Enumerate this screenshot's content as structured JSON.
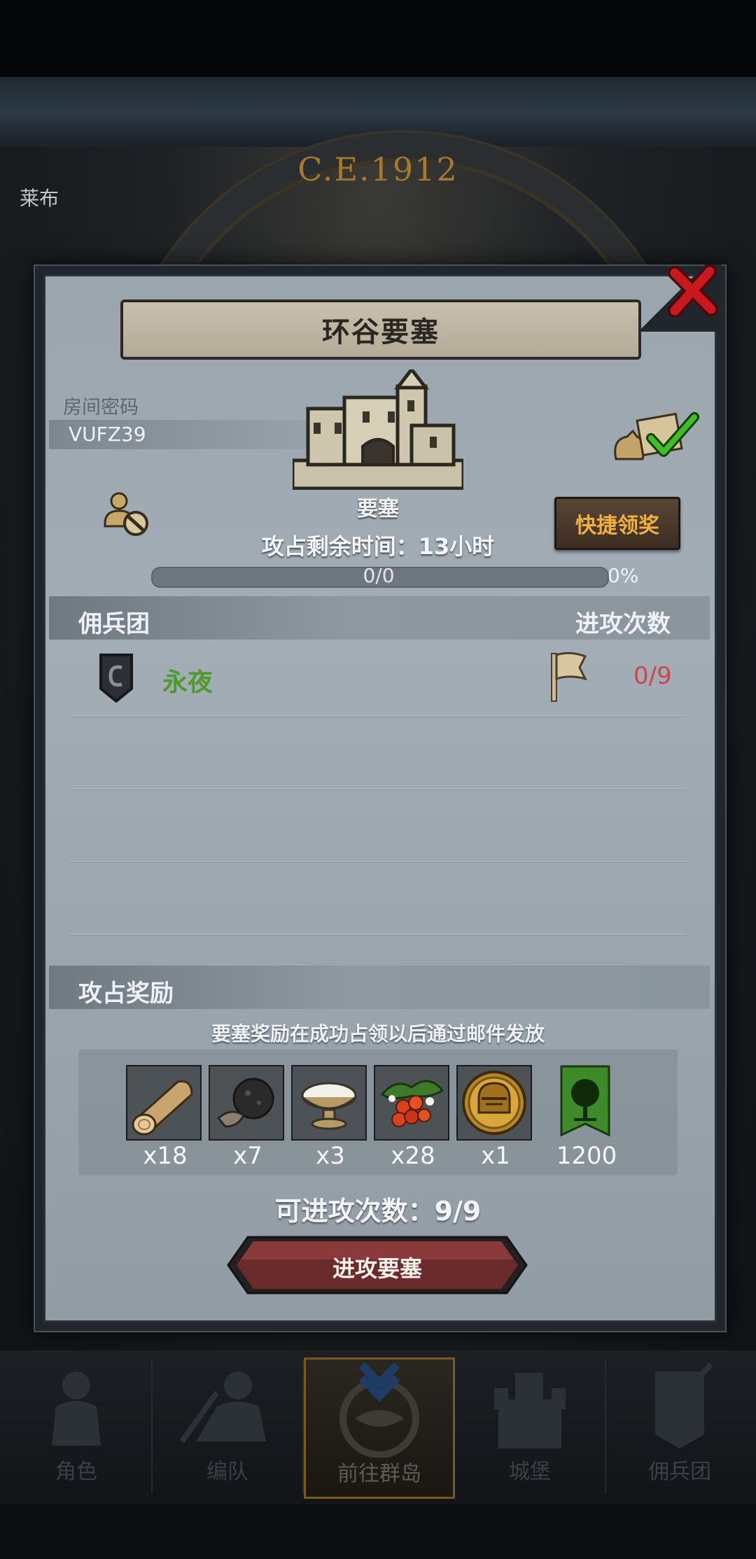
{
  "background": {
    "era_label": "C.E.1912",
    "side_label": "莱布"
  },
  "modal": {
    "title": "环谷要塞",
    "room": {
      "label": "房间密码",
      "code": "VUFZ39"
    },
    "fortress": {
      "type_label": "要塞"
    },
    "time_remaining": "攻占剩余时间：13小时",
    "quick_claim_label": "快捷领奖",
    "progress": {
      "text": "0/0",
      "percent_label": "0%",
      "fraction": 0.0
    },
    "mercenary_header": "佣兵团",
    "attack_count_header": "进攻次数",
    "guilds": [
      {
        "name": "永夜",
        "attacks": "0/9"
      }
    ],
    "rewards_header": "攻占奖励",
    "rewards_note": "要塞奖励在成功占领以后通过邮件发放",
    "rewards": [
      {
        "icon": "log-icon",
        "qty": "x18"
      },
      {
        "icon": "truffle-icon",
        "qty": "x7"
      },
      {
        "icon": "salt-bowl-icon",
        "qty": "x3"
      },
      {
        "icon": "berries-icon",
        "qty": "x28"
      },
      {
        "icon": "knight-helmet-coin-icon",
        "qty": "x1"
      },
      {
        "icon": "guild-banner-icon",
        "qty": "1200"
      }
    ],
    "attempts_label": "可进攻次数：9/9",
    "attack_button_label": "进攻要塞"
  },
  "nav": {
    "items": [
      {
        "label": "角色",
        "icon": "knight-icon"
      },
      {
        "label": "编队",
        "icon": "formation-icon"
      },
      {
        "label": "前往群岛",
        "icon": "compass-icon",
        "active": true
      },
      {
        "label": "城堡",
        "icon": "castle-icon"
      },
      {
        "label": "佣兵团",
        "icon": "mercenary-icon"
      }
    ]
  },
  "colors": {
    "guild_name": "#4e9a2a",
    "attack_count": "#d0434a",
    "quick_claim_text": "#f0b040",
    "close_button": "#c9181e",
    "attack_button": "#6b2a2c"
  }
}
